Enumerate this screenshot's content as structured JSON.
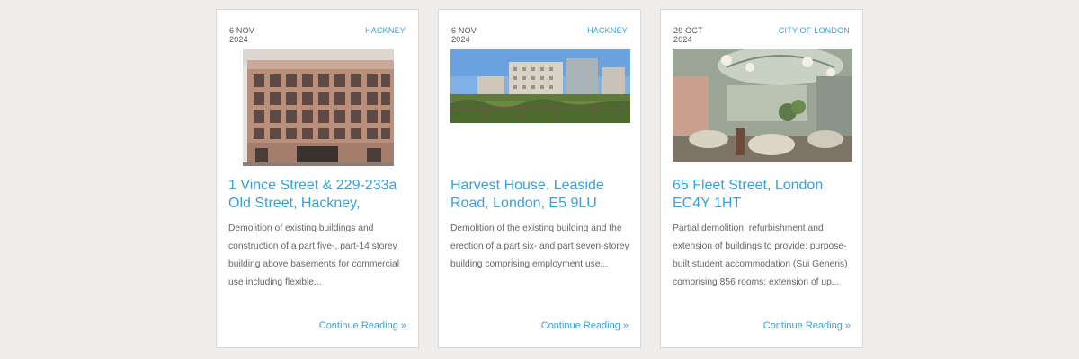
{
  "cards": [
    {
      "date_day": "6 NOV",
      "date_year": "2024",
      "area": "HACKNEY",
      "image_alt": "Brick apartment building facade with grid of windows",
      "title": "1 Vince Street & 229-233a Old Street, Hackney,",
      "description": "Demolition of existing buildings and construction of a part five-, part-14 storey building above basements for commercial use including flexible...",
      "more": "Continue Reading »"
    },
    {
      "date_day": "6 NOV",
      "date_year": "2024",
      "area": "HACKNEY",
      "image_alt": "Residential blocks behind green marshland under blue sky",
      "title": "Harvest House, Leaside Road, London, E5 9LU",
      "description": "Demolition of the existing building and the erection of a part six- and part seven-storey building comprising employment use...",
      "more": "Continue Reading »"
    },
    {
      "date_day": "29 OCT",
      "date_year": "2024",
      "area": "CITY OF LONDON",
      "image_alt": "Interior lounge with curved seating and skylight",
      "title": "65 Fleet Street, London EC4Y 1HT",
      "description": "Partial demolition, refurbishment and extension of buildings to provide: purpose-built student accommodation (Sui Generis) comprising 856 rooms; extension of up...",
      "more": "Continue Reading »"
    }
  ]
}
